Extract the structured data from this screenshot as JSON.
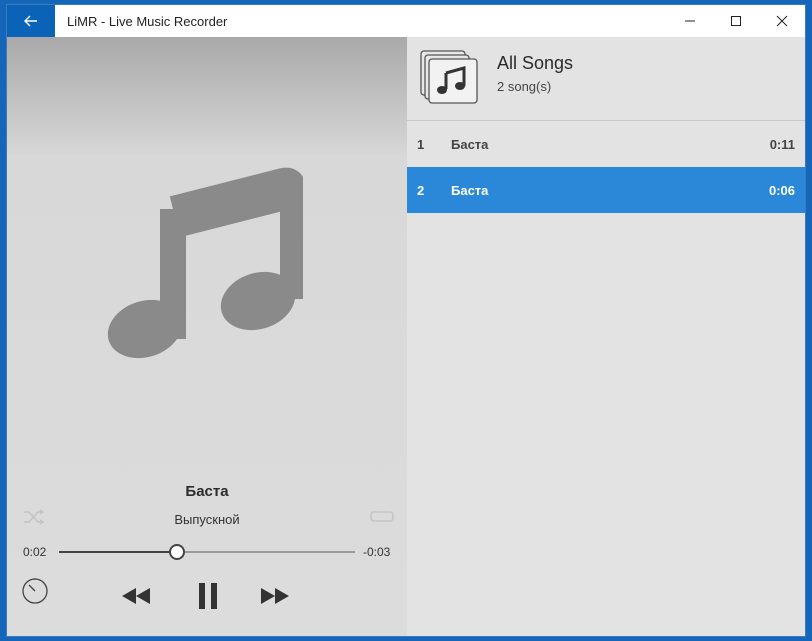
{
  "window": {
    "title": "LiMR - Live Music Recorder"
  },
  "now_playing": {
    "title": "Баста",
    "artist": "Выпускной",
    "elapsed": "0:02",
    "remaining": "-0:03",
    "progress": 0.4
  },
  "playlist": {
    "title": "All Songs",
    "count": "2 song(s)",
    "songs": [
      {
        "num": "1",
        "name": "Баста",
        "duration": "0:11"
      },
      {
        "num": "2",
        "name": "Баста",
        "duration": "0:06"
      }
    ]
  },
  "colors": {
    "accent": "#2b88d8",
    "back_button": "#0a63b6"
  },
  "icons": {
    "back": "back-arrow-icon",
    "minimize": "minimize-icon",
    "maximize": "maximize-icon",
    "close": "close-icon",
    "album_art": "music-note-icon",
    "shuffle": "shuffle-icon",
    "repeat": "repeat-icon",
    "timer": "timer-icon",
    "previous": "rewind-icon",
    "pause": "pause-icon",
    "next": "fast-forward-icon",
    "playlist": "music-library-icon"
  }
}
